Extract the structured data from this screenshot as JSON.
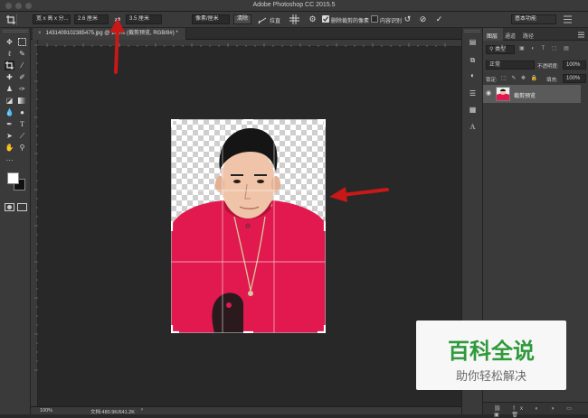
{
  "window": {
    "title": "Adobe Photoshop CC 2015.5"
  },
  "options_bar": {
    "ratio_select": "宽 x 高 x 分...",
    "width_value": "2.6 厘米",
    "swap_icon": "swap-arrows",
    "height_value": "3.5 厘米",
    "unit_select": "像素/厘米",
    "clear_label": "清除",
    "straighten_label": "拉直",
    "delete_pixels_label": "删除裁剪的像素",
    "content_aware_label": "内容识别",
    "workspace_select": "基本功能"
  },
  "document": {
    "tab_label": "1431409102385475.jpg @ 100% (裁剪预览, RGB/8#) *"
  },
  "status": {
    "zoom": "100%",
    "doc_info": "文档:480.9K/641.2K"
  },
  "panel": {
    "tabs": [
      "图层",
      "通道",
      "路径"
    ],
    "kind_label": "类型",
    "blend_mode": "正常",
    "opacity_label": "不透明度:",
    "opacity_value": "100%",
    "lock_label": "锁定:",
    "fill_label": "填充:",
    "fill_value": "100%",
    "layer_name": "裁剪预览"
  },
  "watermark": {
    "title": "百科全说",
    "subtitle": "助你轻松解决"
  },
  "colors": {
    "arrow": "#c81818",
    "shirt": "#e1194e",
    "accent": "#2e5bb4",
    "selected_layer": "#5a5a5a"
  }
}
